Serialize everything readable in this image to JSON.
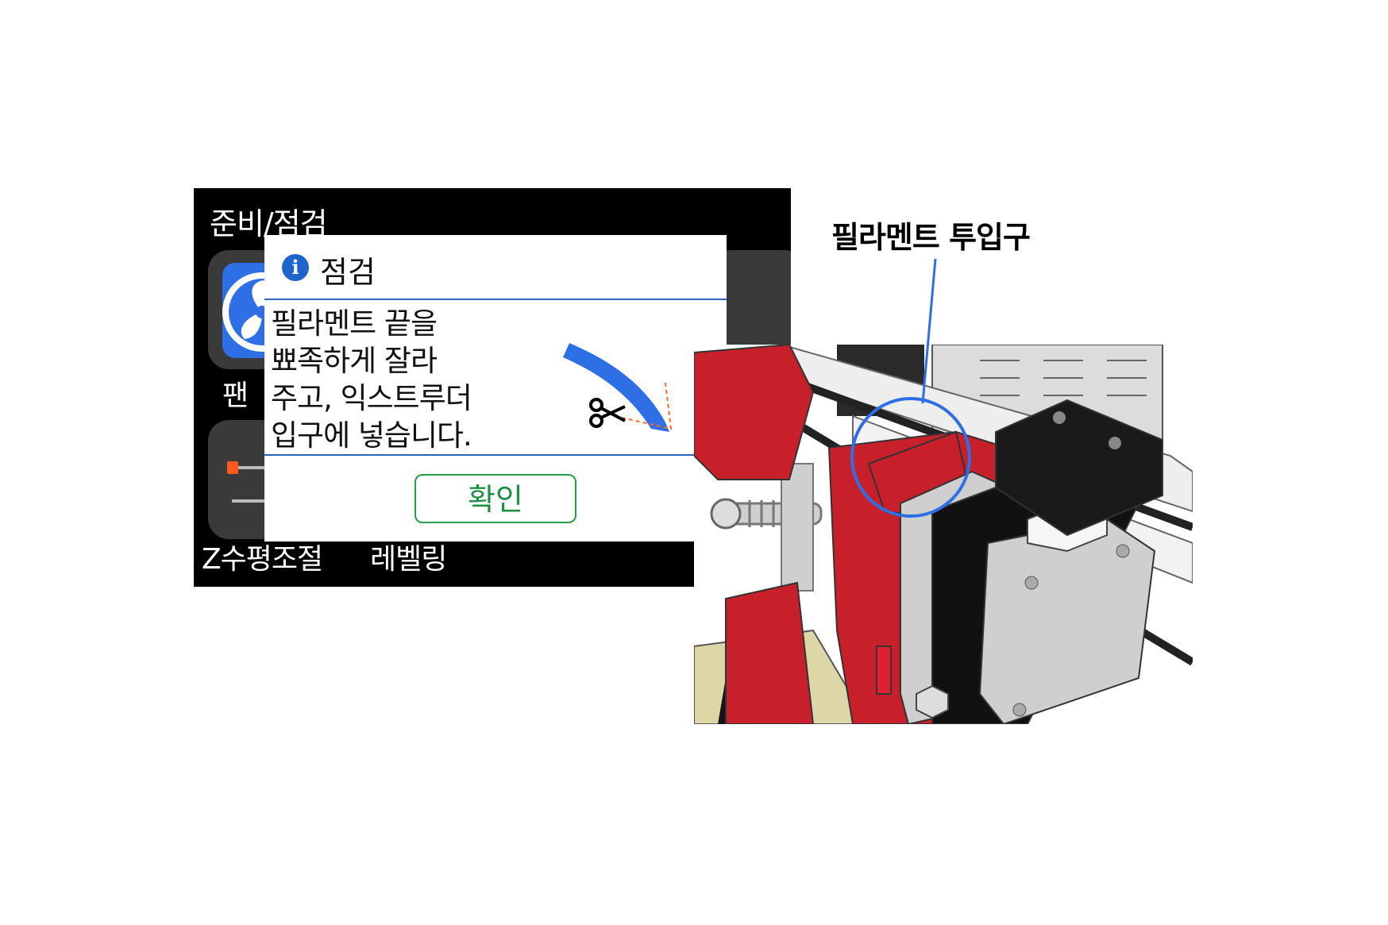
{
  "screen": {
    "title": "준비/점검",
    "tiles": [
      {
        "label": "팬 ",
        "icon": "fan-icon"
      },
      {
        "label": "Z수평조절",
        "icon": "z-level-slider-icon"
      },
      {
        "label": "레벨링",
        "icon": ""
      }
    ]
  },
  "dialog": {
    "icon": "info-icon",
    "title": "점검",
    "message_lines": [
      "필라멘트 끝을",
      "뾰족하게 잘라",
      "주고, 익스트루더",
      "입구에 넣습니다."
    ],
    "ok_label": "확인",
    "illustration_icons": [
      "filament-icon",
      "scissors-icon"
    ]
  },
  "callout": {
    "label": "필라멘트 투입구"
  },
  "colors": {
    "screen_bg": "#000000",
    "tile_bg": "#3a3a3a",
    "accent_blue": "#2f6fe6",
    "divider_blue": "#2a62b8",
    "ok_green": "#1e8f45",
    "extruder_red": "#c8202a"
  }
}
